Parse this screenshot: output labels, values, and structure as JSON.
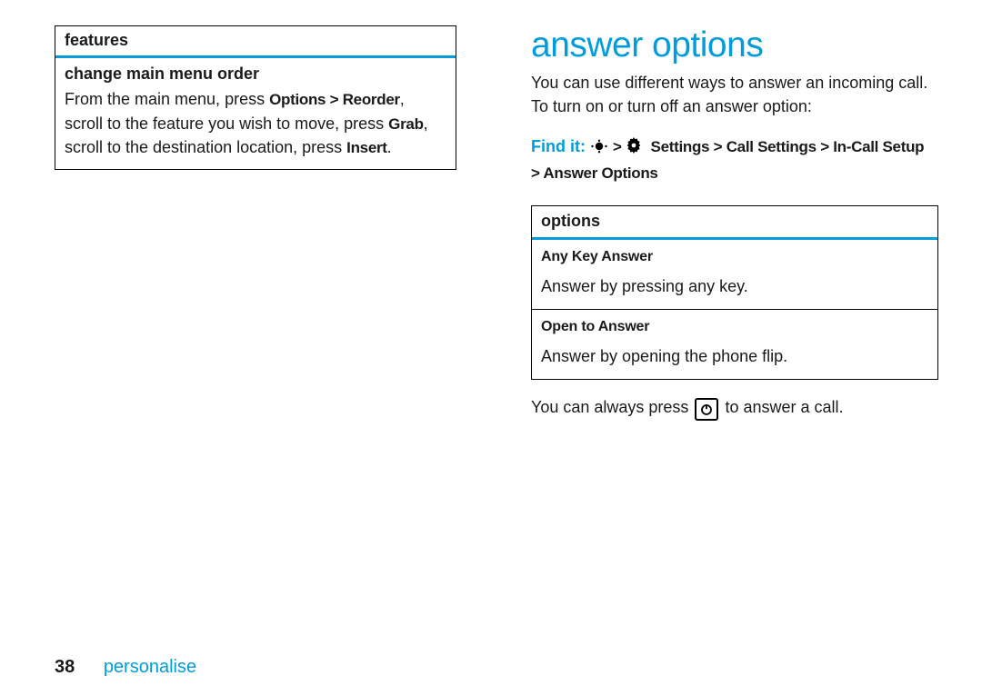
{
  "left": {
    "table_header": "features",
    "feature_name": "change main menu order",
    "desc_pre": "From the main menu, press ",
    "kw_options": "Options",
    "sep1": " > ",
    "kw_reorder": "Reorder",
    "desc_mid1": ", scroll to the feature you wish to move, press ",
    "kw_grab": "Grab",
    "desc_mid2": ", scroll to the destination location, press ",
    "kw_insert": "Insert",
    "desc_end": "."
  },
  "right": {
    "title": "answer options",
    "intro_line1": "You can use different ways to answer an incoming call.",
    "intro_line2": "To turn on or turn off an answer option:",
    "findit_label": "Find it:",
    "findit_sep1": "  >  ",
    "findit_settings": "Settings",
    "findit_sep2": " > ",
    "findit_callsettings": "Call Settings",
    "findit_sep3": " > ",
    "findit_incall": "In-Call Setup",
    "findit_sep4": " > ",
    "findit_answeropts": "Answer Options",
    "options_header": "options",
    "opt1_title": "Any Key Answer",
    "opt1_desc": "Answer by pressing any key.",
    "opt2_title": "Open to Answer",
    "opt2_desc": "Answer by opening the phone flip.",
    "after_pre": "You can always press ",
    "after_post": " to answer a call."
  },
  "footer": {
    "page_number": "38",
    "section": "personalise"
  }
}
